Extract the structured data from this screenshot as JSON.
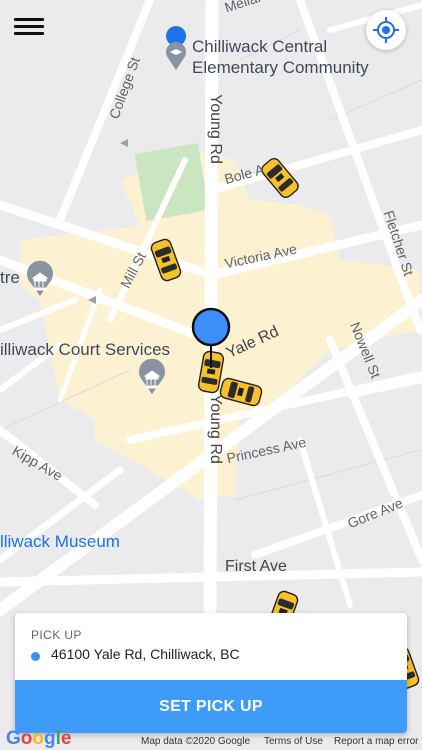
{
  "map": {
    "streets": {
      "melville": "Mellar",
      "college": "College St",
      "young_north": "Young Rd",
      "young_south": "Young Rd",
      "bole": "Bole A",
      "fletcher": "Fletcher St",
      "victoria": "Victoria Ave",
      "mill": "Mill St",
      "yale": "Yale Rd",
      "nowell": "Nowell St",
      "princess": "Princess Ave",
      "kipp": "Kipp Ave",
      "gore": "Gore Ave",
      "first": "First Ave"
    },
    "places": {
      "school": "Chilliwack Central Elementary Community",
      "centre": "tre",
      "court": "illiwack Court Services",
      "museum": "lliwack Museum"
    }
  },
  "pickup": {
    "title": "PICK UP",
    "address": "46100 Yale Rd, Chilliwack, BC",
    "button": "SET PICK UP"
  },
  "footer": {
    "logo": "Google",
    "map_data": "Map data ©2020 Google",
    "terms": "Terms of Use",
    "report": "Report a map error"
  },
  "icons": {
    "menu": "hamburger-menu-icon",
    "locate": "my-location-icon",
    "school": "school-icon",
    "museum": "museum-icon",
    "taxi": "taxi-car-icon",
    "pin": "pickup-pin-icon"
  },
  "colors": {
    "accent": "#3e9bf7",
    "taxi": "#f7c52b",
    "pin": "#3d8ef8",
    "park": "#c9e6c1",
    "zone": "#fcf1d1"
  }
}
